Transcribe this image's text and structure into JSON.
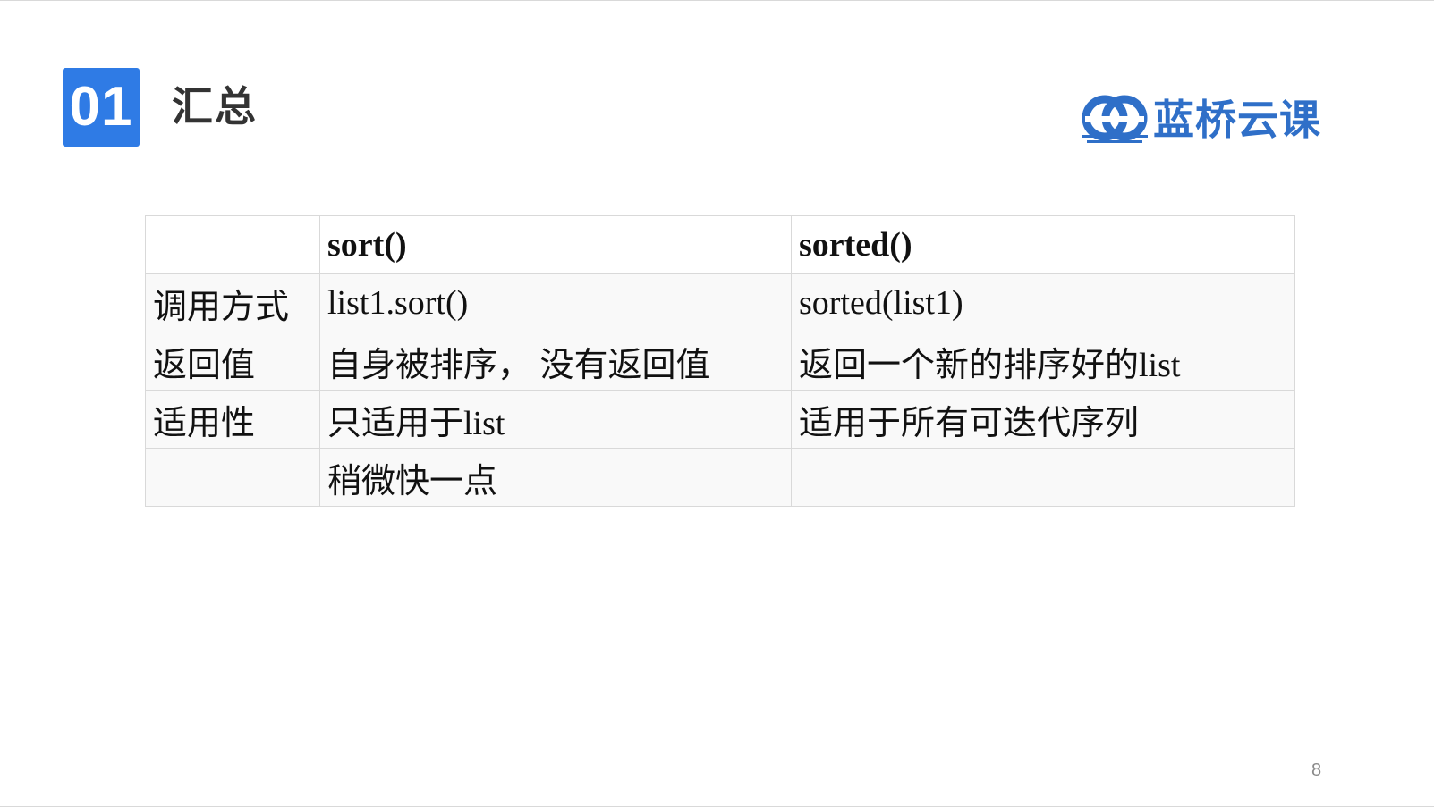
{
  "header": {
    "section_number": "01",
    "section_title": "汇总"
  },
  "logo": {
    "text": "蓝桥云课",
    "mark_icon": "lanqiao-logo-mark",
    "color": "#2f6fc8"
  },
  "table": {
    "columns": [
      "",
      "sort()",
      "sorted()"
    ],
    "rows": [
      [
        "调用方式",
        "list1.sort()",
        "sorted(list1)"
      ],
      [
        "返回值",
        "自身被排序， 没有返回值",
        "返回一个新的排序好的list"
      ],
      [
        "适用性",
        "只适用于list",
        "适用于所有可迭代序列"
      ],
      [
        "",
        "稍微快一点",
        ""
      ]
    ]
  },
  "footer": {
    "page_number": "8"
  },
  "colors": {
    "accent": "#2f7be5",
    "table_border": "#d9d9d9"
  }
}
